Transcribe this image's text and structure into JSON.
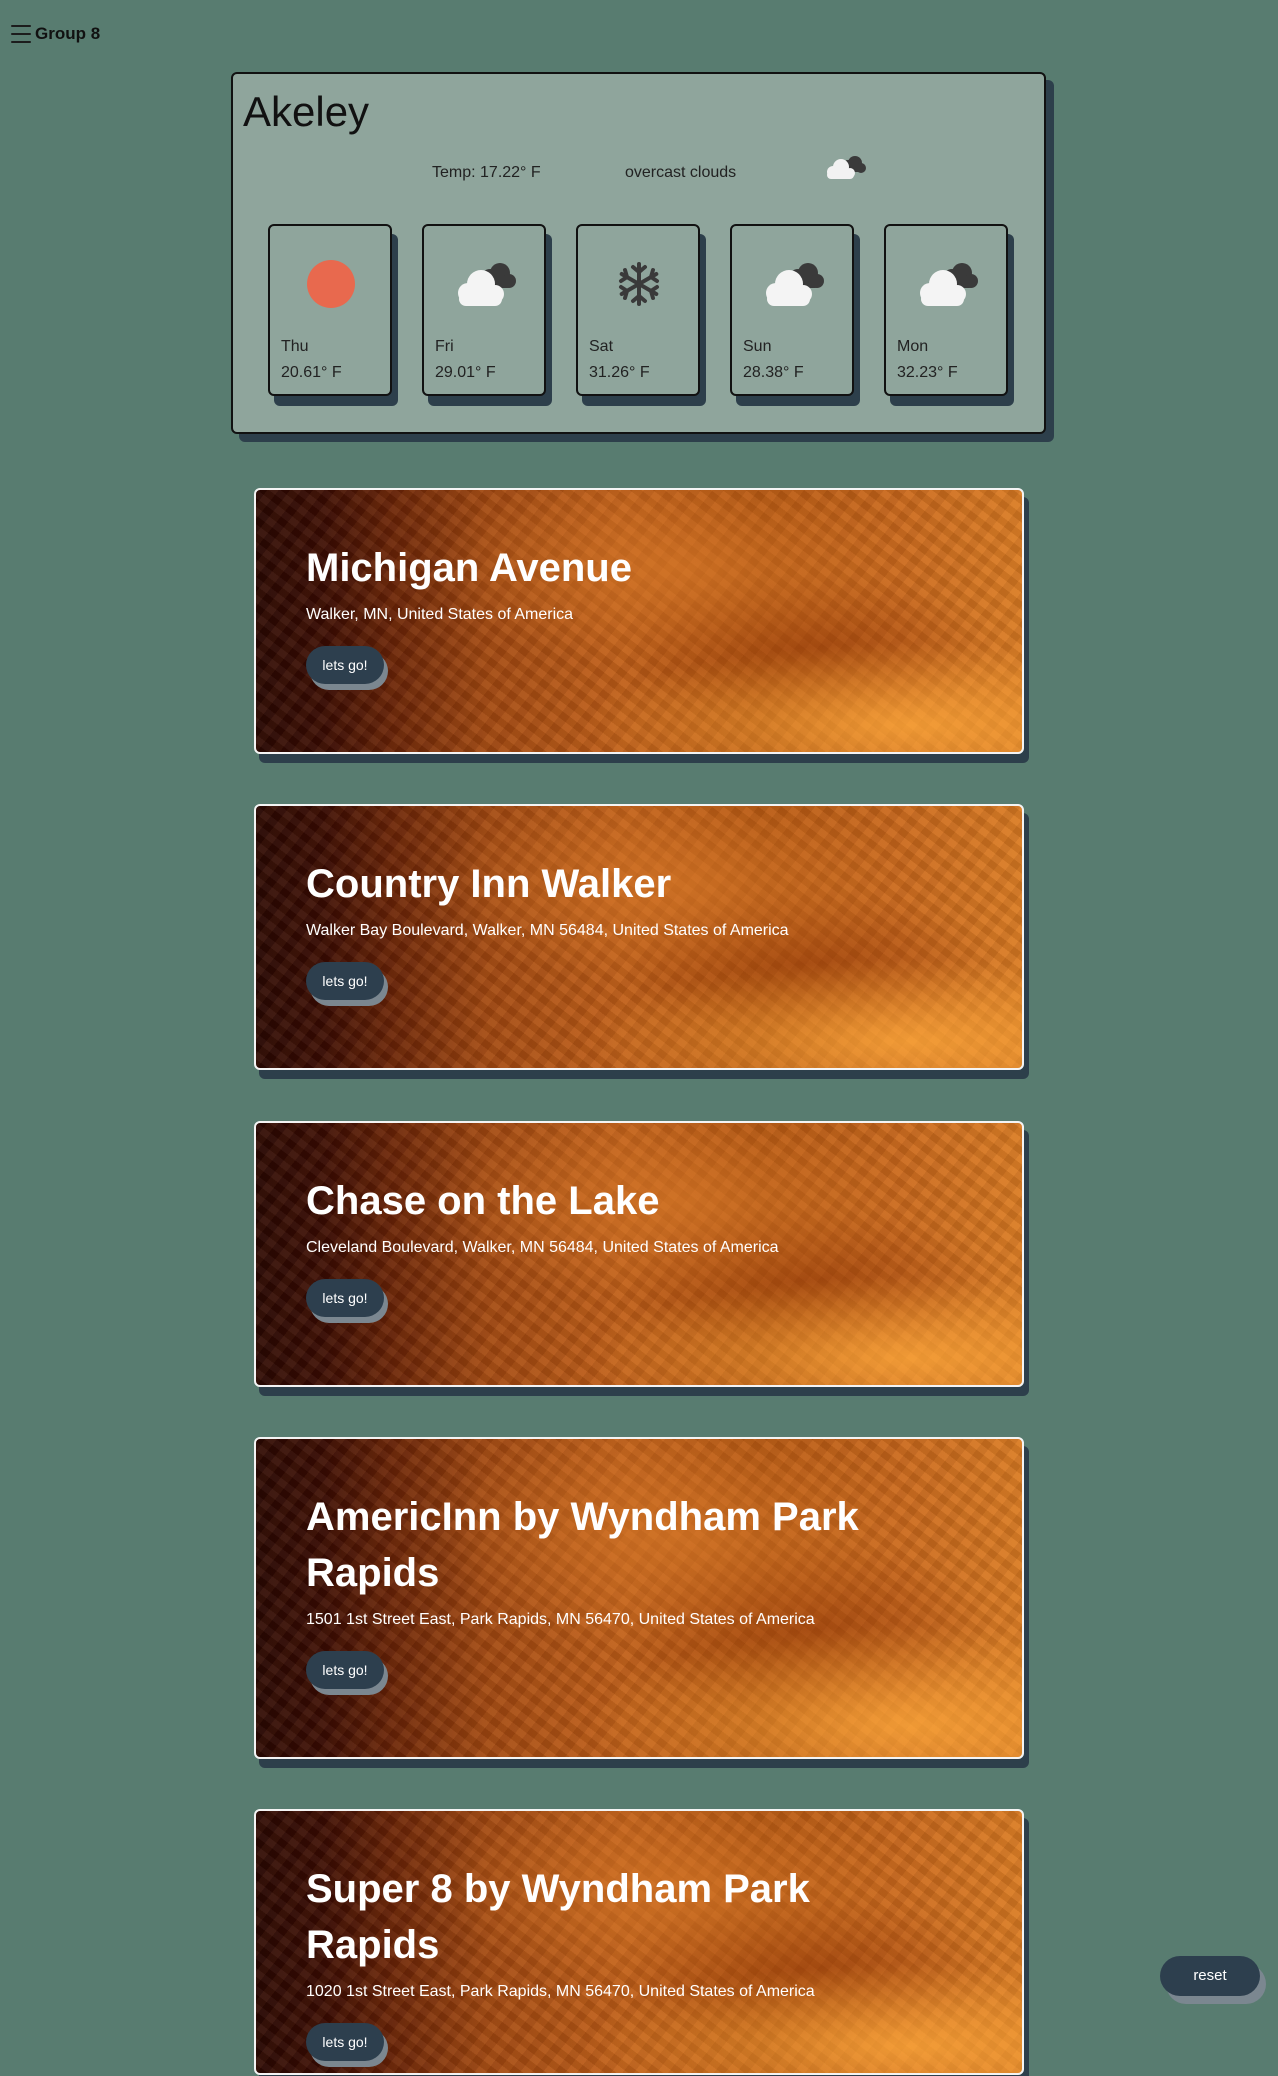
{
  "header": {
    "menu_icon": "hamburger-icon",
    "title": "Group 8"
  },
  "weather": {
    "city": "Akeley",
    "current_temp": "Temp: 17.22° F",
    "description": "overcast clouds",
    "current_icon": "overcast-clouds-icon",
    "forecast": [
      {
        "day": "Thu",
        "temp": "20.61° F",
        "icon": "sun-icon"
      },
      {
        "day": "Fri",
        "temp": "29.01° F",
        "icon": "cloud-icon"
      },
      {
        "day": "Sat",
        "temp": "31.26° F",
        "icon": "snowflake-icon"
      },
      {
        "day": "Sun",
        "temp": "28.38° F",
        "icon": "cloud-icon"
      },
      {
        "day": "Mon",
        "temp": "32.23° F",
        "icon": "cloud-icon"
      }
    ]
  },
  "places": [
    {
      "name": "Michigan Avenue",
      "address": "Walker, MN, United States of America",
      "button": "lets go!"
    },
    {
      "name": "Country Inn Walker",
      "address": "Walker Bay Boulevard, Walker, MN 56484, United States of America",
      "button": "lets go!"
    },
    {
      "name": "Chase on the Lake",
      "address": "Cleveland Boulevard, Walker, MN 56484, United States of America",
      "button": "lets go!"
    },
    {
      "name": "AmericInn by Wyndham Park Rapids",
      "address": "1501 1st Street East, Park Rapids, MN 56470, United States of America",
      "button": "lets go!"
    },
    {
      "name": "Super 8 by Wyndham Park Rapids",
      "address": "1020 1st Street East, Park Rapids, MN 56470, United States of America",
      "button": "lets go!"
    }
  ],
  "reset_label": "reset",
  "colors": {
    "background": "#587c70",
    "panel": "#8fa59c",
    "button": "#2d3f4e",
    "sun": "#e8694e"
  }
}
